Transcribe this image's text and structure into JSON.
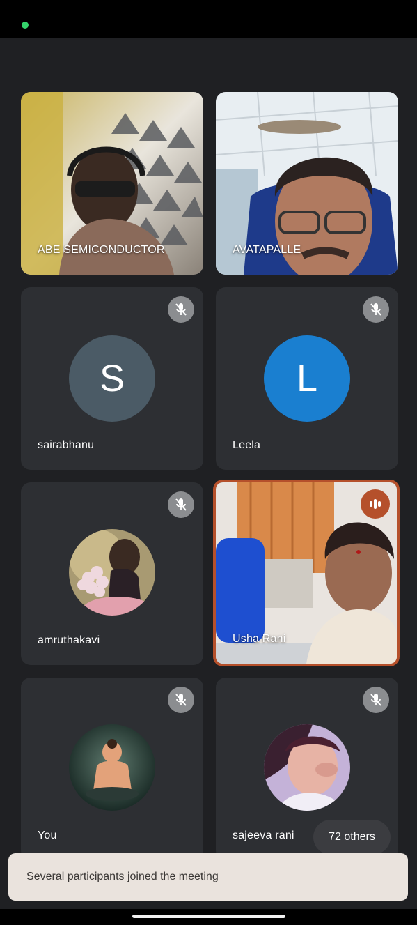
{
  "participants": [
    {
      "name": "ABE SEMICONDUCTOR",
      "type": "video"
    },
    {
      "name": "AVATAPALLE",
      "type": "video"
    },
    {
      "name": "sairabhanu",
      "type": "avatar",
      "initial": "S",
      "color": "#4b5b66",
      "muted": true
    },
    {
      "name": "Leela",
      "type": "avatar",
      "initial": "L",
      "color": "#1a7fd0",
      "muted": true
    },
    {
      "name": "amruthakavi",
      "type": "photo",
      "muted": true
    },
    {
      "name": "Usha Rani",
      "type": "video",
      "speaking": true
    },
    {
      "name": "You",
      "type": "photo",
      "muted": true
    },
    {
      "name": "sajeeva rani",
      "type": "photo",
      "muted": true
    }
  ],
  "others_count_label": "72 others",
  "toast_message": "Several participants joined the meeting",
  "icons": {
    "mute": "mic-off-icon",
    "speaking": "audio-level-icon"
  },
  "colors": {
    "background": "#1f2023",
    "tile": "#2d2f33",
    "speaking_border": "#b5502b",
    "toast": "#eae3dd"
  }
}
